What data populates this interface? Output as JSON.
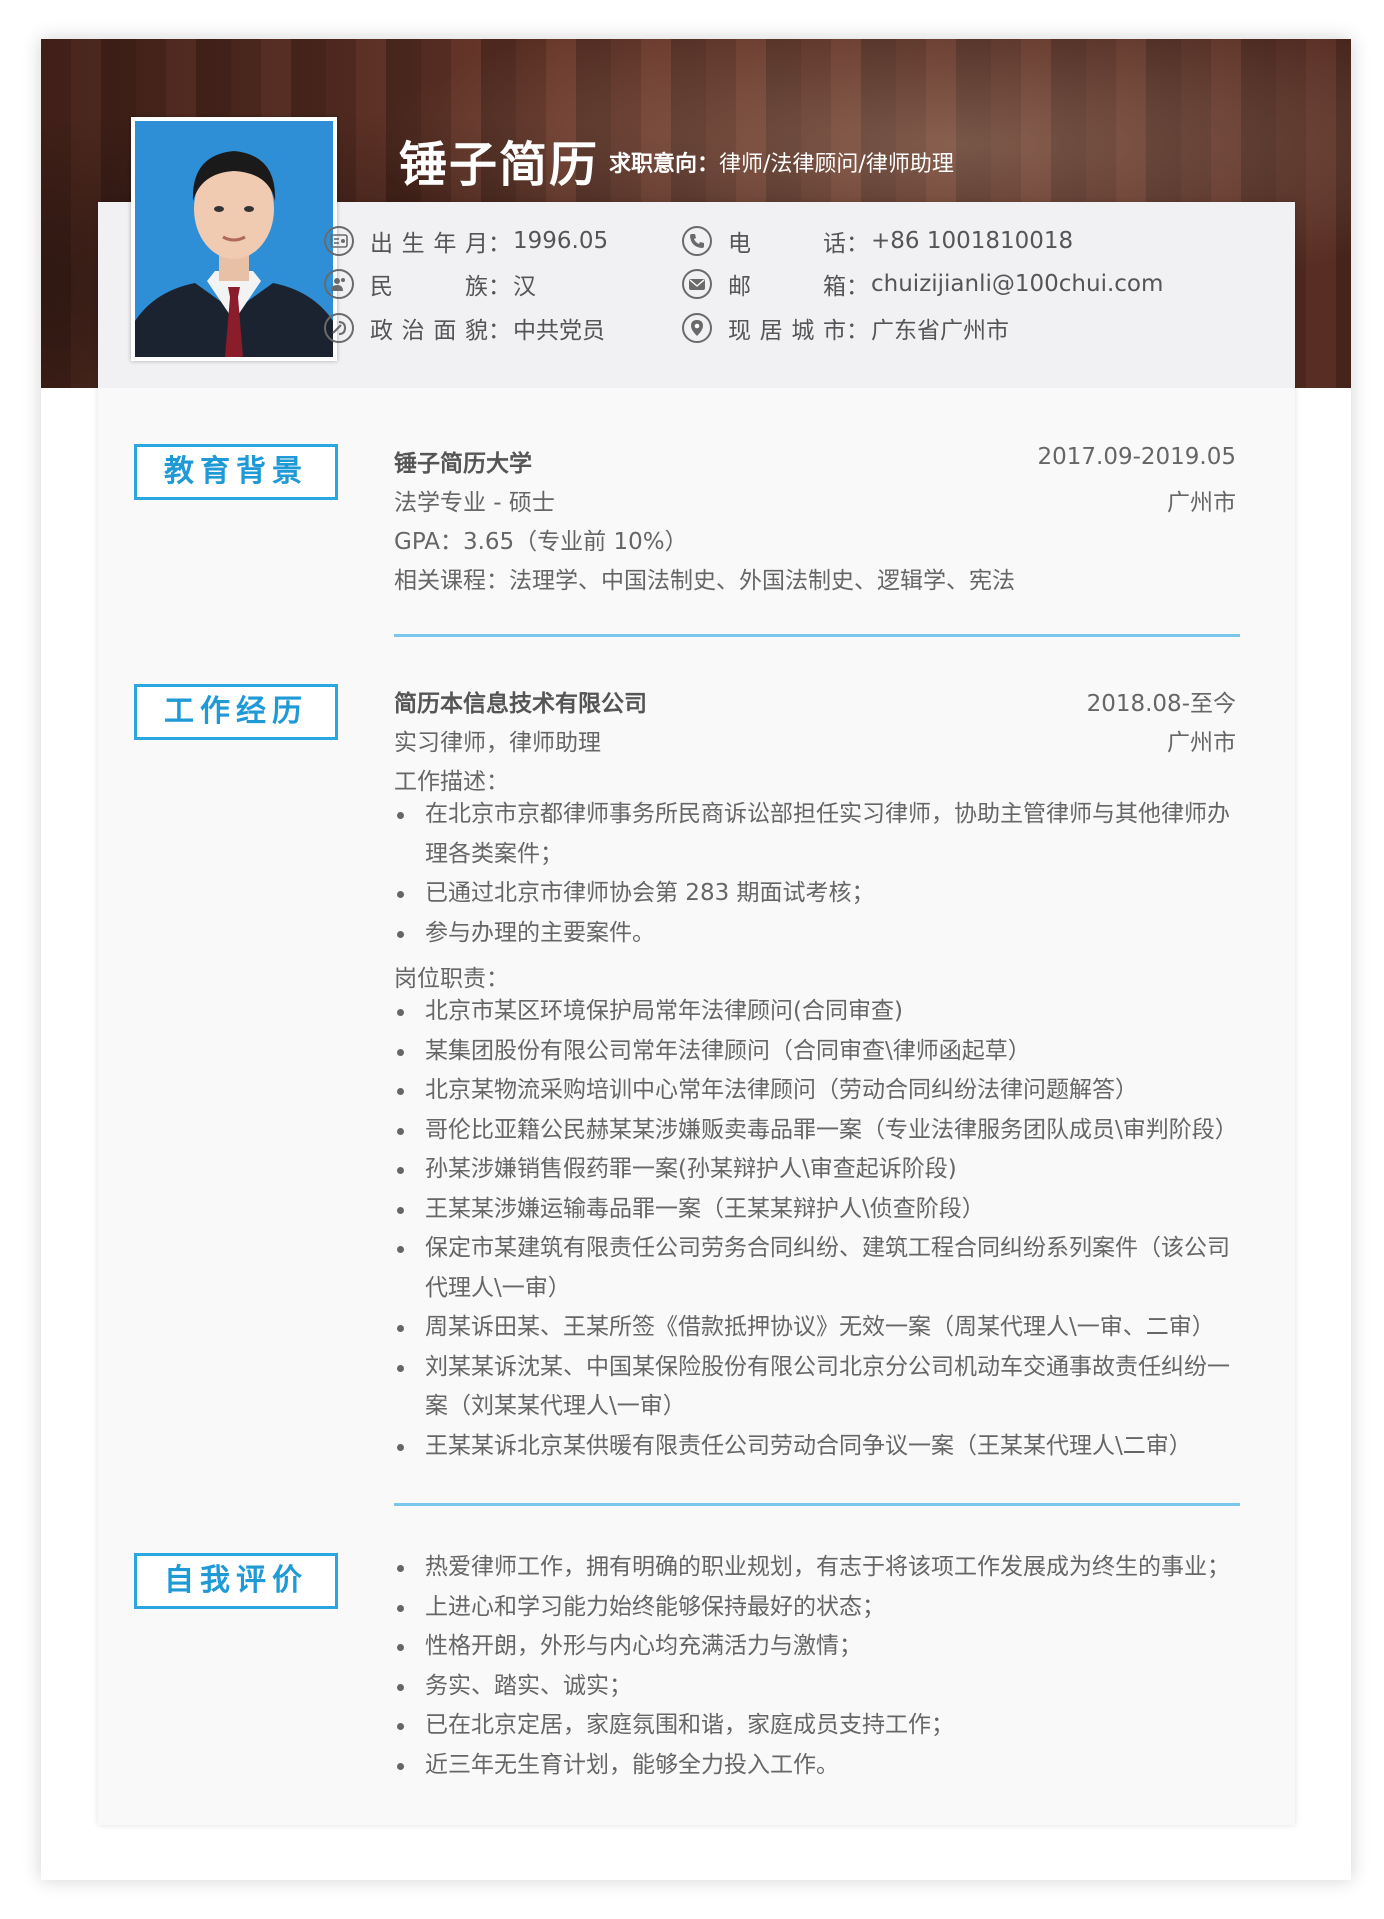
{
  "header": {
    "name": "锤子简历",
    "intent_label": "求职意向：",
    "intent_value": "律师/法律顾问/律师助理"
  },
  "info": [
    {
      "icon": "id-card-icon",
      "label": "出生年月",
      "value": "1996.05"
    },
    {
      "icon": "people-icon",
      "label": "民族",
      "value": "汉"
    },
    {
      "icon": "party-emblem-icon",
      "label": "政治面貌",
      "value": "中共党员"
    },
    {
      "icon": "phone-icon",
      "label": "电话",
      "value": "+86 1001810018"
    },
    {
      "icon": "mail-icon",
      "label": "邮箱",
      "value": "chuizijianli@100chui.com"
    },
    {
      "icon": "location-icon",
      "label": "现居城市",
      "value": "广东省广州市"
    }
  ],
  "education": {
    "title": "教育背景",
    "school": "锤子简历大学",
    "date": "2017.09-2019.05",
    "major": "法学专业 - 硕士",
    "city": "广州市",
    "gpa": "GPA：3.65（专业前 10%）",
    "courses": "相关课程：法理学、中国法制史、外国法制史、逻辑学、宪法"
  },
  "work": {
    "title": "工作经历",
    "company": "简历本信息技术有限公司",
    "date": "2018.08-至今",
    "role": "实习律师，律师助理",
    "city": "广州市",
    "desc_label": "工作描述：",
    "desc_items": [
      "在北京市京都律师事务所民商诉讼部担任实习律师，协助主管律师与其他律师办理各类案件；",
      "已通过北京市律师协会第 283 期面试考核；",
      "参与办理的主要案件。"
    ],
    "duty_label": "岗位职责：",
    "duty_items": [
      "北京市某区环境保护局常年法律顾问(合同审查)",
      "某集团股份有限公司常年法律顾问（合同审查\\律师函起草）",
      "北京某物流采购培训中心常年法律顾问（劳动合同纠纷法律问题解答）",
      "哥伦比亚籍公民赫某某涉嫌贩卖毒品罪一案（专业法律服务团队成员\\审判阶段）",
      "孙某涉嫌销售假药罪一案(孙某辩护人\\审查起诉阶段)",
      "王某某涉嫌运输毒品罪一案（王某某辩护人\\侦查阶段）",
      "保定市某建筑有限责任公司劳务合同纠纷、建筑工程合同纠纷系列案件（该公司代理人\\一审）",
      "周某诉田某、王某所签《借款抵押协议》无效一案（周某代理人\\一审、二审）",
      "刘某某诉沈某、中国某保险股份有限公司北京分公司机动车交通事故责任纠纷一案（刘某某代理人\\一审）",
      "王某某诉北京某供暖有限责任公司劳动合同争议一案（王某某代理人\\二审）"
    ]
  },
  "self": {
    "title": "自我评价",
    "items": [
      "热爱律师工作，拥有明确的职业规划，有志于将该项工作发展成为终生的事业；",
      "上进心和学习能力始终能够保持最好的状态；",
      "性格开朗，外形与内心均充满活力与激情；",
      "务实、踏实、诚实；",
      "已在北京定居，家庭氛围和谐，家庭成员支持工作；",
      "近三年无生育计划，能够全力投入工作。"
    ]
  },
  "colors": {
    "accent": "#2aa6e0",
    "divider": "#7bc6ec",
    "photo_bg": "#2e8fd6"
  }
}
